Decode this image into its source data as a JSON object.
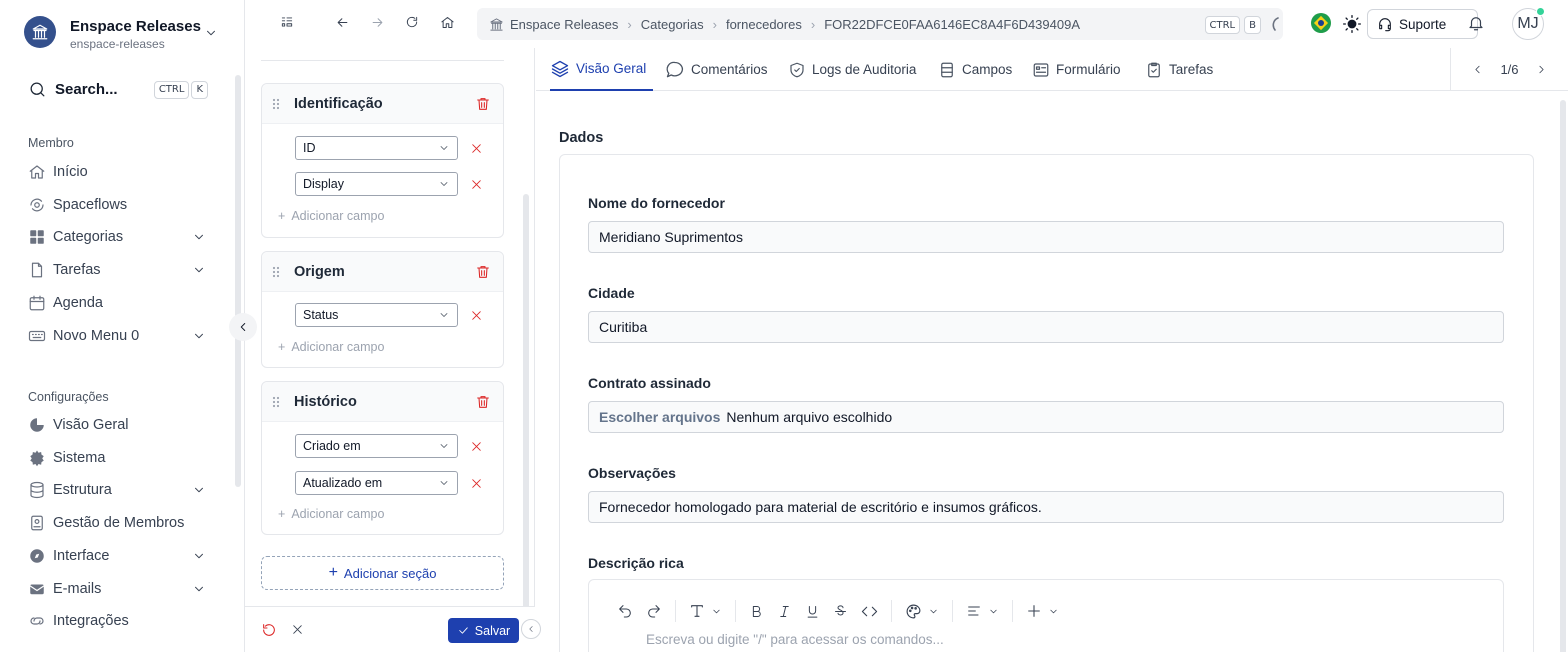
{
  "workspace": {
    "name": "Enspace Releases",
    "slug": "enspace-releases"
  },
  "search": {
    "label": "Search...",
    "keys": [
      "CTRL",
      "K"
    ]
  },
  "sidebar": {
    "member_title": "Membro",
    "member_items": [
      {
        "label": "Início",
        "icon": "home-icon",
        "expandable": false
      },
      {
        "label": "Spaceflows",
        "icon": "spaceflows-icon",
        "expandable": false
      },
      {
        "label": "Categorias",
        "icon": "grid-icon",
        "expandable": true
      },
      {
        "label": "Tarefas",
        "icon": "file-icon",
        "expandable": true
      },
      {
        "label": "Agenda",
        "icon": "calendar-icon",
        "expandable": false
      },
      {
        "label": "Novo Menu 0",
        "icon": "keyboard-icon",
        "expandable": true
      }
    ],
    "config_title": "Configurações",
    "config_items": [
      {
        "label": "Visão Geral",
        "icon": "pie-icon",
        "expandable": false
      },
      {
        "label": "Sistema",
        "icon": "gear-icon",
        "expandable": false
      },
      {
        "label": "Estrutura",
        "icon": "database-icon",
        "expandable": true
      },
      {
        "label": "Gestão de Membros",
        "icon": "badge-icon",
        "expandable": false
      },
      {
        "label": "Interface",
        "icon": "compass-icon",
        "expandable": true
      },
      {
        "label": "E-mails",
        "icon": "mail-icon",
        "expandable": true
      },
      {
        "label": "Integrações",
        "icon": "link-icon",
        "expandable": false
      }
    ]
  },
  "breadcrumb": {
    "items": [
      "Enspace Releases",
      "Categorias",
      "fornecedores",
      "FOR22DFCE0FAA6146EC8A4F6D439409A"
    ],
    "keys": [
      "CTRL",
      "B"
    ]
  },
  "header": {
    "support_label": "Suporte",
    "avatar_initials": "MJ"
  },
  "builder": {
    "sections": [
      {
        "title": "Identificação",
        "fields": [
          "ID",
          "Display"
        ]
      },
      {
        "title": "Origem",
        "fields": [
          "Status"
        ]
      },
      {
        "title": "Histórico",
        "fields": [
          "Criado em",
          "Atualizado em"
        ]
      }
    ],
    "add_field_label": "Adicionar campo",
    "add_section_label": "Adicionar seção",
    "save_label": "Salvar"
  },
  "tabs": [
    {
      "label": "Visão Geral",
      "icon": "layers-icon",
      "active": true
    },
    {
      "label": "Comentários",
      "icon": "comment-icon",
      "active": false
    },
    {
      "label": "Logs de Auditoria",
      "icon": "shield-icon",
      "active": false
    },
    {
      "label": "Campos",
      "icon": "fields-icon",
      "active": false
    },
    {
      "label": "Formulário",
      "icon": "form-icon",
      "active": false
    },
    {
      "label": "Tarefas",
      "icon": "clipboard-icon",
      "active": false
    }
  ],
  "pager": {
    "text": "1/6"
  },
  "record": {
    "section_title": "Dados",
    "fields": [
      {
        "label": "Nome do fornecedor",
        "value": "Meridiano Suprimentos"
      },
      {
        "label": "Cidade",
        "value": "Curitiba"
      },
      {
        "label": "Contrato assinado",
        "button": "Escolher arquivos",
        "value": "Nenhum arquivo escolhido"
      },
      {
        "label": "Observações",
        "value": "Fornecedor homologado para material de escritório e insumos gráficos."
      }
    ],
    "rich_label": "Descrição rica",
    "rich_placeholder": "Escreva ou digite \"/\" para acessar os comandos..."
  }
}
